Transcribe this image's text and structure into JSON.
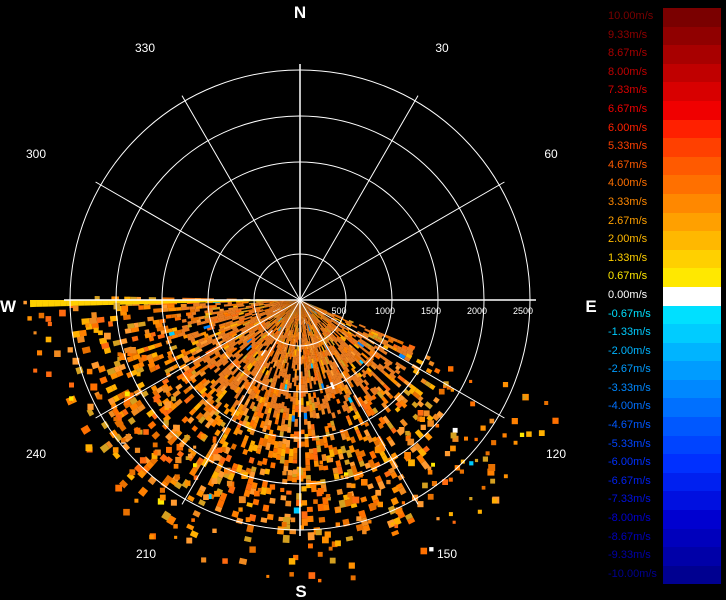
{
  "compass": {
    "north": "N",
    "east": "E",
    "south": "S",
    "west": "W"
  },
  "azimuth_labels": [
    "30",
    "60",
    "120",
    "150",
    "210",
    "240",
    "300",
    "330"
  ],
  "range_labels": [
    "500",
    "1000",
    "1500",
    "2000",
    "2500"
  ],
  "legend": [
    {
      "label": "10.00m/s",
      "color": "#7a0000"
    },
    {
      "label": "9.33m/s",
      "color": "#900000"
    },
    {
      "label": "8.67m/s",
      "color": "#a80000"
    },
    {
      "label": "8.00m/s",
      "color": "#c00000"
    },
    {
      "label": "7.33m/s",
      "color": "#d80000"
    },
    {
      "label": "6.67m/s",
      "color": "#f00000"
    },
    {
      "label": "6.00m/s",
      "color": "#ff2000"
    },
    {
      "label": "5.33m/s",
      "color": "#ff4000"
    },
    {
      "label": "4.67m/s",
      "color": "#ff5a00"
    },
    {
      "label": "4.00m/s",
      "color": "#ff7000"
    },
    {
      "label": "3.33m/s",
      "color": "#ff8800"
    },
    {
      "label": "2.67m/s",
      "color": "#ffa000"
    },
    {
      "label": "2.00m/s",
      "color": "#ffb800"
    },
    {
      "label": "1.33m/s",
      "color": "#ffd000"
    },
    {
      "label": "0.67m/s",
      "color": "#ffe800"
    },
    {
      "label": "0.00m/s",
      "color": "#ffffff"
    },
    {
      "label": "-0.67m/s",
      "color": "#00e0ff"
    },
    {
      "label": "-1.33m/s",
      "color": "#00ccff"
    },
    {
      "label": "-2.00m/s",
      "color": "#00b4ff"
    },
    {
      "label": "-2.67m/s",
      "color": "#009cff"
    },
    {
      "label": "-3.33m/s",
      "color": "#0088ff"
    },
    {
      "label": "-4.00m/s",
      "color": "#0070ff"
    },
    {
      "label": "-4.67m/s",
      "color": "#0058ff"
    },
    {
      "label": "-5.33m/s",
      "color": "#0044ff"
    },
    {
      "label": "-6.00m/s",
      "color": "#0030ff"
    },
    {
      "label": "-6.67m/s",
      "color": "#0020f0"
    },
    {
      "label": "-7.33m/s",
      "color": "#0010e0"
    },
    {
      "label": "-8.00m/s",
      "color": "#0000d0"
    },
    {
      "label": "-8.67m/s",
      "color": "#0000bc"
    },
    {
      "label": "-9.33m/s",
      "color": "#0000a8"
    },
    {
      "label": "-10.00m/s",
      "color": "#000090"
    }
  ]
}
